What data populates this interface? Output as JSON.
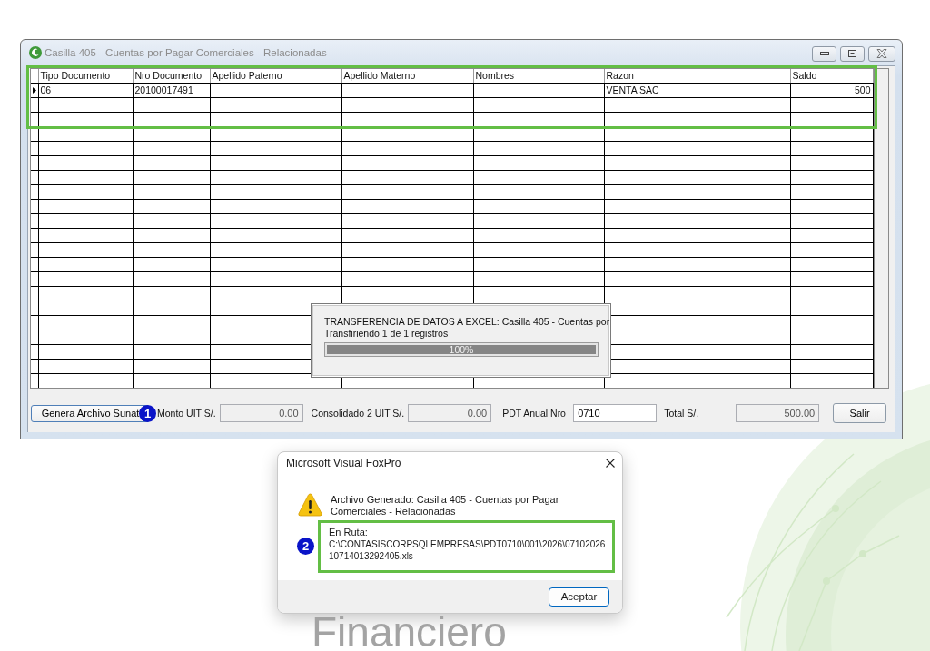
{
  "window": {
    "title": "Casilla 405 - Cuentas por Pagar Comerciales - Relacionadas",
    "active": false
  },
  "grid": {
    "highlighted": true,
    "columns": [
      {
        "label": "Tipo Documento",
        "kind": "text"
      },
      {
        "label": "Nro Documento",
        "kind": "text"
      },
      {
        "label": "Apellido Paterno",
        "kind": "text"
      },
      {
        "label": "Apellido Materno",
        "kind": "text"
      },
      {
        "label": "Nombres",
        "kind": "text"
      },
      {
        "label": "Razon",
        "kind": "text"
      },
      {
        "label": "Saldo",
        "kind": "number"
      }
    ],
    "rows": [
      {
        "selected": true,
        "cells": [
          "06",
          "20100017491",
          null,
          null,
          null,
          "VENTA SAC",
          "500"
        ]
      }
    ]
  },
  "progress_dialog": {
    "message": "TRANSFERENCIA DE DATOS A EXCEL: Casilla 405 - Cuentas por",
    "status": "Transfiriendo 1 de 1 registros",
    "level": 1,
    "percent": "100%"
  },
  "toolbar": {
    "generate_button": {
      "label": "Genera Archivo Sunat",
      "step_badge": "1"
    },
    "fields": [
      {
        "label": "Monto UIT S/.",
        "value": "0.00",
        "kind": "number",
        "disabled": true
      },
      {
        "label": "Consolidado 2 UIT S/.",
        "value": "0.00",
        "kind": "number",
        "disabled": true
      },
      {
        "label": "PDT Anual Nro",
        "value": "0710",
        "kind": "text",
        "disabled": false
      },
      {
        "label": "Total S/.",
        "value": "500.00",
        "kind": "number",
        "disabled": true
      }
    ],
    "exit_button": "Salir"
  },
  "message_box": {
    "title": "Microsoft Visual FoxPro",
    "message": "Archivo Generado: Casilla 405 - Cuentas por Pagar Comerciales - Relacionadas",
    "route": {
      "label": "En Ruta:",
      "path_lines": [
        "C:\\CONTASISCORPSQLEMPRESAS\\PDT0710\\001\\2026\\07102026",
        "10714013292405.xls"
      ],
      "step_badge": "2",
      "highlighted": true
    },
    "buttons": [
      {
        "label": "Aceptar",
        "default": true
      }
    ]
  },
  "background": {
    "caption": "Financiero"
  }
}
